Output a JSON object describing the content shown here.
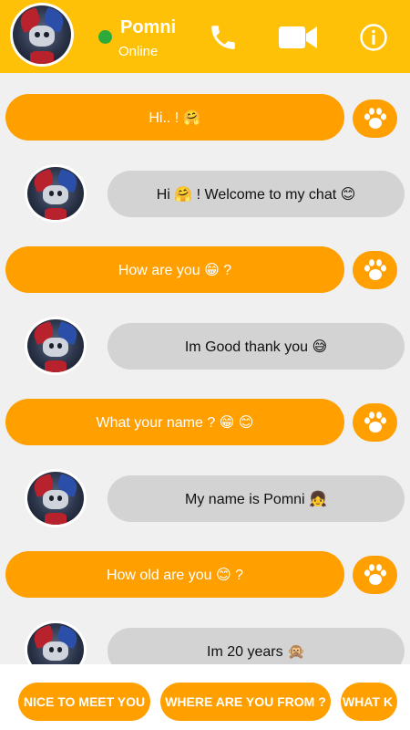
{
  "header": {
    "name": "Pomni",
    "status": "Online",
    "bg_color": "#ffc107",
    "status_dot_color": "#2eaa3a",
    "icons": [
      "phone-icon",
      "video-camera-icon",
      "info-icon"
    ]
  },
  "messages": [
    {
      "from": "me",
      "text": "Hi.. ! 🤗"
    },
    {
      "from": "contact",
      "text": "Hi 🤗 ! Welcome to my chat 😊"
    },
    {
      "from": "me",
      "text": "How are you 😁 ?"
    },
    {
      "from": "contact",
      "text": "Im Good thank you 😅"
    },
    {
      "from": "me",
      "text": "What your name ? 😁 😊"
    },
    {
      "from": "contact",
      "text": "My name is Pomni 👧"
    },
    {
      "from": "me",
      "text": "How old are you 😊 ?"
    },
    {
      "from": "contact",
      "text": "Im 20 years 🙊"
    }
  ],
  "suggestions": [
    "NICE TO MEET YOU",
    "WHERE ARE YOU FROM ?",
    "WHAT K"
  ],
  "colors": {
    "outgoing": "#ff9f00",
    "incoming": "#d3d3d3",
    "background": "#f0f0f0"
  }
}
